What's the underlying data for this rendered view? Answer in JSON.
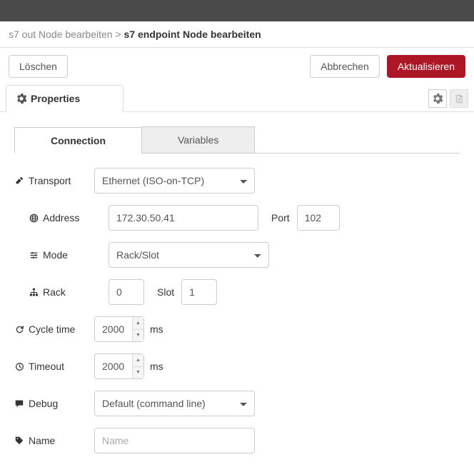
{
  "breadcrumb": {
    "parent": "s7 out Node bearbeiten",
    "sep": ">",
    "current": "s7 endpoint Node bearbeiten"
  },
  "buttons": {
    "delete": "Löschen",
    "cancel": "Abbrechen",
    "update": "Aktualisieren"
  },
  "propsTab": "Properties",
  "subtabs": {
    "connection": "Connection",
    "variables": "Variables"
  },
  "form": {
    "transport": {
      "label": "Transport",
      "value": "Ethernet (ISO-on-TCP)"
    },
    "address": {
      "label": "Address",
      "value": "172.30.50.41",
      "portLabel": "Port",
      "portValue": "102"
    },
    "mode": {
      "label": "Mode",
      "value": "Rack/Slot"
    },
    "rack": {
      "label": "Rack",
      "value": "0",
      "slotLabel": "Slot",
      "slotValue": "1"
    },
    "cycle": {
      "label": "Cycle time",
      "value": "2000",
      "unit": "ms"
    },
    "timeout": {
      "label": "Timeout",
      "value": "2000",
      "unit": "ms"
    },
    "debug": {
      "label": "Debug",
      "value": "Default (command line)"
    },
    "name": {
      "label": "Name",
      "placeholder": "Name",
      "value": ""
    }
  }
}
